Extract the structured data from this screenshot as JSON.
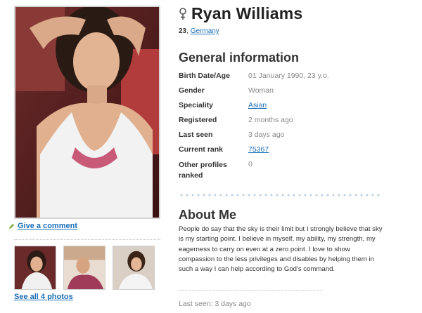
{
  "profile": {
    "name": "Ryan Williams",
    "age": "23",
    "age_sep": ",",
    "country": "Germany",
    "gender_icon": "female-symbol-icon"
  },
  "general": {
    "title": "General information",
    "rows": [
      {
        "label": "Birth Date/Age",
        "value": "01 January 1990, 23 y.o."
      },
      {
        "label": "Gender",
        "value": "Woman"
      },
      {
        "label": "Speciality",
        "value": "Asian"
      },
      {
        "label": "Registered",
        "value": "2 months ago"
      },
      {
        "label": "Last seen",
        "value": "3 days ago"
      },
      {
        "label": "Current rank",
        "value": "75367"
      },
      {
        "label": "Other profiles ranked",
        "value": "0"
      }
    ]
  },
  "about": {
    "title": "About Me",
    "text": "People do say that the sky is their limit but I strongly believe that sky is my starting point. I believe in myself, my ability, my strength, my eagerness to carry on even at a zero point. I love to show compassion to the less privileges and disables by helping them in such a way I can help according to God's command."
  },
  "left": {
    "comment_label": "Give a comment",
    "see_all_label": "See all 4 photos"
  },
  "footer": {
    "last_seen": "Last seen: 3 days ago"
  },
  "colors": {
    "link": "#1a6eb5",
    "muted": "#888888"
  }
}
